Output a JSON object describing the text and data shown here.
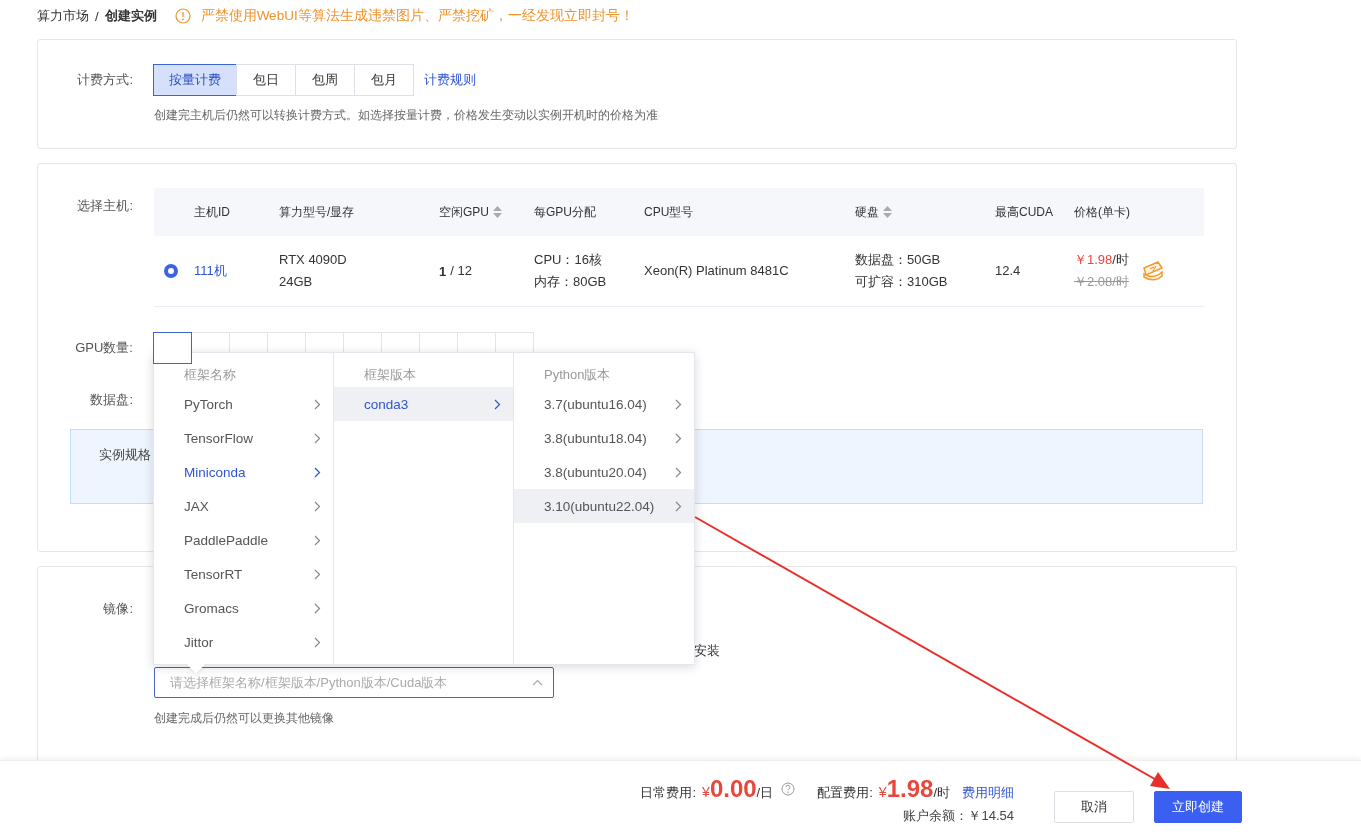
{
  "breadcrumb": [
    {
      "label": "算力市场"
    },
    {
      "label": "创建实例"
    }
  ],
  "breadcrumb_separator": "/",
  "notice": "严禁使用WebUI等算法生成违禁图片、严禁挖矿，一经发现立即封号！",
  "billing": {
    "label": "计费方式:",
    "options": [
      {
        "label": "按量计费",
        "selected": true
      },
      {
        "label": "包日",
        "selected": false
      },
      {
        "label": "包周",
        "selected": false
      },
      {
        "label": "包月",
        "selected": false
      }
    ],
    "rules_link": "计费规则",
    "hint": "创建完主机后仍然可以转换计费方式。如选择按量计费，价格发生变动以实例开机时的价格为准"
  },
  "host": {
    "label": "选择主机:",
    "columns": [
      {
        "label": "主机ID",
        "sortable": false
      },
      {
        "label": "算力型号/显存",
        "sortable": false
      },
      {
        "label": "空闲GPU",
        "sortable": true
      },
      {
        "label": "每GPU分配",
        "sortable": false
      },
      {
        "label": "CPU型号",
        "sortable": false
      },
      {
        "label": "硬盘",
        "sortable": true
      },
      {
        "label": "最高CUDA",
        "sortable": false
      },
      {
        "label": "价格(单卡)",
        "sortable": false
      }
    ],
    "rows": [
      {
        "selected": true,
        "id": "111机",
        "model": [
          "RTX 4090D",
          "24GB"
        ],
        "gpu_free": "1",
        "gpu_total": "/ 12",
        "alloc": [
          "CPU：16核",
          "内存：80GB"
        ],
        "cpu": "Xeon(R) Platinum 8481C",
        "disk": [
          "数据盘：50GB",
          "可扩容：310GB"
        ],
        "cuda": "12.4",
        "price": "￥1.98",
        "price_unit": "/时",
        "old_price": "￥2.08/时",
        "discount": true
      }
    ]
  },
  "gpu_count": {
    "label": "GPU数量:",
    "options": [
      {
        "selected": true
      },
      {
        "selected": false
      },
      {
        "selected": false
      },
      {
        "selected": false
      },
      {
        "selected": false
      },
      {
        "selected": false
      },
      {
        "selected": false
      },
      {
        "selected": false
      },
      {
        "selected": false
      },
      {
        "selected": false
      }
    ]
  },
  "data_disk": {
    "label": "数据盘:"
  },
  "spec_box": {
    "label": "实例规格"
  },
  "image": {
    "label": "镜像:",
    "trailing_text": "安装",
    "placeholder": "请选择框架名称/框架版本/Python版本/Cuda版本",
    "hint": "创建完成后仍然可以更换其他镜像"
  },
  "cascader": {
    "columns": [
      {
        "title": "框架名称",
        "items": [
          {
            "label": "PyTorch",
            "selected": false,
            "highlighted": false
          },
          {
            "label": "TensorFlow",
            "selected": false,
            "highlighted": false
          },
          {
            "label": "Miniconda",
            "selected": true,
            "highlighted": false
          },
          {
            "label": "JAX",
            "selected": false,
            "highlighted": false
          },
          {
            "label": "PaddlePaddle",
            "selected": false,
            "highlighted": false
          },
          {
            "label": "TensorRT",
            "selected": false,
            "highlighted": false
          },
          {
            "label": "Gromacs",
            "selected": false,
            "highlighted": false
          },
          {
            "label": "Jittor",
            "selected": false,
            "highlighted": false
          }
        ]
      },
      {
        "title": "框架版本",
        "items": [
          {
            "label": "conda3",
            "selected": true,
            "highlighted": true
          }
        ]
      },
      {
        "title": "Python版本",
        "items": [
          {
            "label": "3.7(ubuntu16.04)",
            "selected": false,
            "highlighted": false
          },
          {
            "label": "3.8(ubuntu18.04)",
            "selected": false,
            "highlighted": false
          },
          {
            "label": "3.8(ubuntu20.04)",
            "selected": false,
            "highlighted": false
          },
          {
            "label": "3.10(ubuntu22.04)",
            "selected": false,
            "highlighted": true
          }
        ]
      }
    ]
  },
  "footer": {
    "daily_label": "日常费用:",
    "daily_currency": "¥",
    "daily_amount": "0.00",
    "daily_unit": "/日",
    "config_label": "配置费用:",
    "config_currency": "¥",
    "config_amount": "1.98",
    "config_unit": "/时",
    "detail_link": "费用明细",
    "balance": "账户余额：￥14.54",
    "cancel": "取消",
    "create": "立即创建"
  }
}
